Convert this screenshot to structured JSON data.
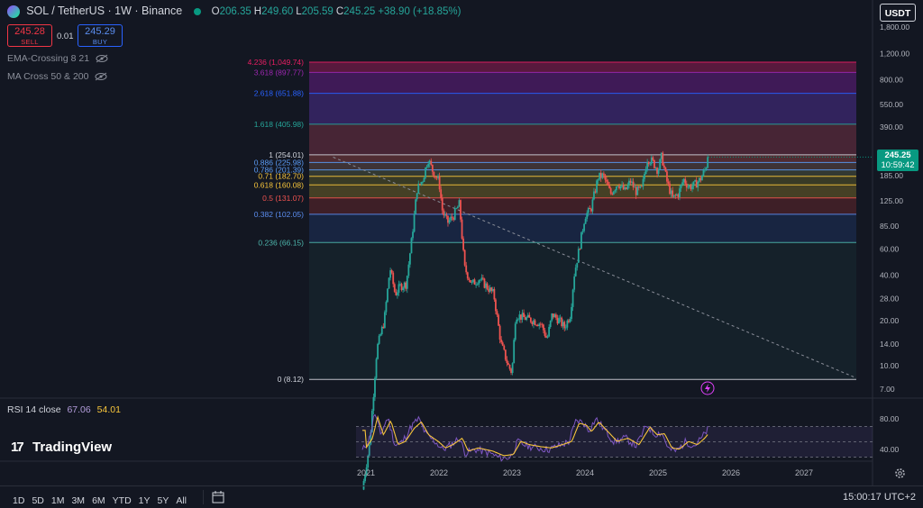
{
  "header": {
    "symbol": "SOL / TetherUS · 1W · Binance",
    "ohlc": [
      {
        "k": "O",
        "v": "206.35"
      },
      {
        "k": "H",
        "v": "249.60"
      },
      {
        "k": "L",
        "v": "205.59"
      },
      {
        "k": "C",
        "v": "245.25"
      },
      {
        "k": "",
        "v": "+38.90 (+18.85%)"
      }
    ],
    "sell_price": "245.28",
    "sell_label": "SELL",
    "spread": "0.01",
    "buy_price": "245.29",
    "buy_label": "BUY",
    "currency": "USDT",
    "indicators": [
      "EMA-Crossing 8 21",
      "MA Cross 50 & 200"
    ]
  },
  "current_price": {
    "value": "245.25",
    "countdown": "10:59:42"
  },
  "rsi": {
    "label": "RSI 14 close",
    "value1": "67.06",
    "value2": "54.01",
    "ticks": [
      "80.00",
      "40.00"
    ],
    "color1": "#7e57c2",
    "color2": "#f7c53b"
  },
  "bottom": {
    "ranges": [
      "1D",
      "5D",
      "1M",
      "3M",
      "6M",
      "YTD",
      "1Y",
      "5Y",
      "All"
    ],
    "clock": "15:00:17 UTC+2",
    "logo": "TradingView"
  },
  "colors": {
    "up": "#26a69a",
    "down": "#ef5350",
    "bg": "#131722"
  },
  "chart_data": {
    "type": "candlestick",
    "title": "SOL / TetherUS · 1W · Binance",
    "y_scale": "log",
    "y_ticks": [
      1800,
      1200,
      800,
      550,
      390,
      265,
      185,
      125,
      85,
      60,
      40,
      28,
      20,
      14,
      10,
      7
    ],
    "y_tick_labels": [
      "1,800.00",
      "1,200.00",
      "800.00",
      "550.00",
      "390.00",
      "265.00",
      "185.00",
      "125.00",
      "85.00",
      "60.00",
      "40.00",
      "28.00",
      "20.00",
      "14.00",
      "10.00",
      "7.00"
    ],
    "x_ticks": [
      "2021",
      "2022",
      "2023",
      "2024",
      "2025",
      "2026",
      "2027"
    ],
    "fib_levels": [
      {
        "ratio": "4.236",
        "price": 1049.74,
        "label": "4.236 (1,049.74)",
        "color": "#e91e63"
      },
      {
        "ratio": "3.618",
        "price": 897.77,
        "label": "3.618 (897.77)",
        "color": "#9c27b0"
      },
      {
        "ratio": "2.618",
        "price": 651.88,
        "label": "2.618 (651.88)",
        "color": "#2962ff"
      },
      {
        "ratio": "1.618",
        "price": 405.98,
        "label": "1.618 (405.98)",
        "color": "#26a69a"
      },
      {
        "ratio": "1",
        "price": 254.01,
        "label": "1 (254.01)",
        "color": "#d1d4dc"
      },
      {
        "ratio": "0.886",
        "price": 225.98,
        "label": "0.886 (225.98)",
        "color": "#5b9cf6"
      },
      {
        "ratio": "0.786",
        "price": 201.39,
        "label": "0.786 (201.39)",
        "color": "#5b9cf6"
      },
      {
        "ratio": "0.71",
        "price": 182.7,
        "label": "0.71 (182.70)",
        "color": "#f7c53b"
      },
      {
        "ratio": "0.618",
        "price": 160.08,
        "label": "0.618 (160.08)",
        "color": "#f7c53b"
      },
      {
        "ratio": "0.5",
        "price": 131.07,
        "label": "0.5 (131.07)",
        "color": "#ef5350"
      },
      {
        "ratio": "0.382",
        "price": 102.05,
        "label": "0.382 (102.05)",
        "color": "#5b8def"
      },
      {
        "ratio": "0.236",
        "price": 66.15,
        "label": "0.236 (66.15)",
        "color": "#4db6ac"
      },
      {
        "ratio": "0",
        "price": 8.12,
        "label": "0 (8.12)",
        "color": "#d1d4dc"
      }
    ],
    "weekly_close_anchors": [
      {
        "t": 2020.95,
        "v": 1.5
      },
      {
        "t": 2021.05,
        "v": 3.0
      },
      {
        "t": 2021.15,
        "v": 13
      },
      {
        "t": 2021.25,
        "v": 20
      },
      {
        "t": 2021.33,
        "v": 45
      },
      {
        "t": 2021.4,
        "v": 30
      },
      {
        "t": 2021.47,
        "v": 34
      },
      {
        "t": 2021.55,
        "v": 35
      },
      {
        "t": 2021.62,
        "v": 65
      },
      {
        "t": 2021.7,
        "v": 150
      },
      {
        "t": 2021.78,
        "v": 175
      },
      {
        "t": 2021.85,
        "v": 240
      },
      {
        "t": 2021.92,
        "v": 195
      },
      {
        "t": 2022.0,
        "v": 170
      },
      {
        "t": 2022.05,
        "v": 105
      },
      {
        "t": 2022.12,
        "v": 90
      },
      {
        "t": 2022.2,
        "v": 100
      },
      {
        "t": 2022.28,
        "v": 120
      },
      {
        "t": 2022.35,
        "v": 45
      },
      {
        "t": 2022.45,
        "v": 35
      },
      {
        "t": 2022.55,
        "v": 38
      },
      {
        "t": 2022.65,
        "v": 34
      },
      {
        "t": 2022.75,
        "v": 30
      },
      {
        "t": 2022.85,
        "v": 14
      },
      {
        "t": 2022.95,
        "v": 10
      },
      {
        "t": 2023.0,
        "v": 9
      },
      {
        "t": 2023.05,
        "v": 22
      },
      {
        "t": 2023.15,
        "v": 21
      },
      {
        "t": 2023.3,
        "v": 20
      },
      {
        "t": 2023.4,
        "v": 19
      },
      {
        "t": 2023.48,
        "v": 15
      },
      {
        "t": 2023.55,
        "v": 22
      },
      {
        "t": 2023.65,
        "v": 20
      },
      {
        "t": 2023.72,
        "v": 18
      },
      {
        "t": 2023.8,
        "v": 22
      },
      {
        "t": 2023.85,
        "v": 40
      },
      {
        "t": 2023.92,
        "v": 60
      },
      {
        "t": 2024.0,
        "v": 100
      },
      {
        "t": 2024.08,
        "v": 110
      },
      {
        "t": 2024.18,
        "v": 180
      },
      {
        "t": 2024.25,
        "v": 185
      },
      {
        "t": 2024.35,
        "v": 140
      },
      {
        "t": 2024.45,
        "v": 165
      },
      {
        "t": 2024.55,
        "v": 145
      },
      {
        "t": 2024.62,
        "v": 170
      },
      {
        "t": 2024.7,
        "v": 145
      },
      {
        "t": 2024.78,
        "v": 150
      },
      {
        "t": 2024.85,
        "v": 240
      },
      {
        "t": 2024.92,
        "v": 230
      },
      {
        "t": 2025.0,
        "v": 200
      },
      {
        "t": 2025.05,
        "v": 250
      },
      {
        "t": 2025.12,
        "v": 170
      },
      {
        "t": 2025.2,
        "v": 130
      },
      {
        "t": 2025.28,
        "v": 140
      },
      {
        "t": 2025.35,
        "v": 175
      },
      {
        "t": 2025.42,
        "v": 155
      },
      {
        "t": 2025.5,
        "v": 160
      },
      {
        "t": 2025.58,
        "v": 175
      },
      {
        "t": 2025.65,
        "v": 205
      },
      {
        "t": 2025.69,
        "v": 245.25
      }
    ]
  }
}
